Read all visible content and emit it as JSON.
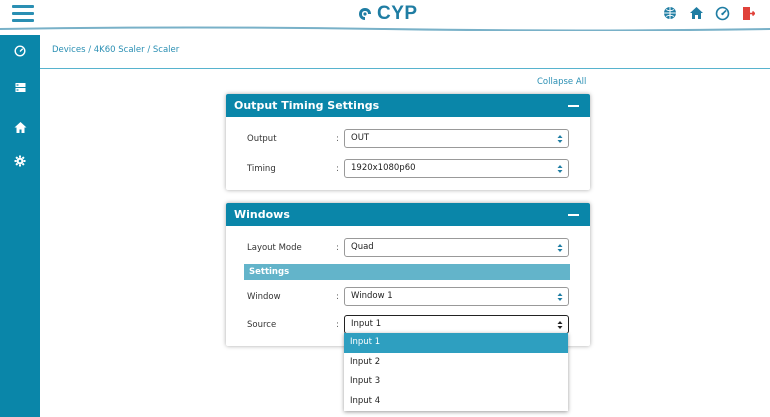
{
  "header": {
    "logo_text": "CYP",
    "icons": [
      "globe-icon",
      "home-icon",
      "dashboard-icon",
      "logout-icon"
    ]
  },
  "sidebar": {
    "items": [
      "dashboard-icon",
      "device-list-icon",
      "home-network-icon",
      "settings-gear-icon"
    ]
  },
  "breadcrumb": "Devices / 4K60 Scaler / Scaler",
  "collapse_all": "Collapse All",
  "output_timing": {
    "title": "Output Timing Settings",
    "output_label": "Output",
    "output_value": "OUT",
    "timing_label": "Timing",
    "timing_value": "1920x1080p60"
  },
  "windows": {
    "title": "Windows",
    "layout_mode_label": "Layout Mode",
    "layout_mode_value": "Quad",
    "settings_label": "Settings",
    "window_label": "Window",
    "window_value": "Window 1",
    "source_label": "Source",
    "source_value": "Input 1"
  },
  "colon": ":",
  "source_options": [
    "Input 1",
    "Input 2",
    "Input 3",
    "Input 4"
  ],
  "colors": {
    "accent": "#0a86a9",
    "settings_bar": "#63b4ca",
    "selected_option": "#2e9fc0",
    "logout": "#e0413a"
  }
}
